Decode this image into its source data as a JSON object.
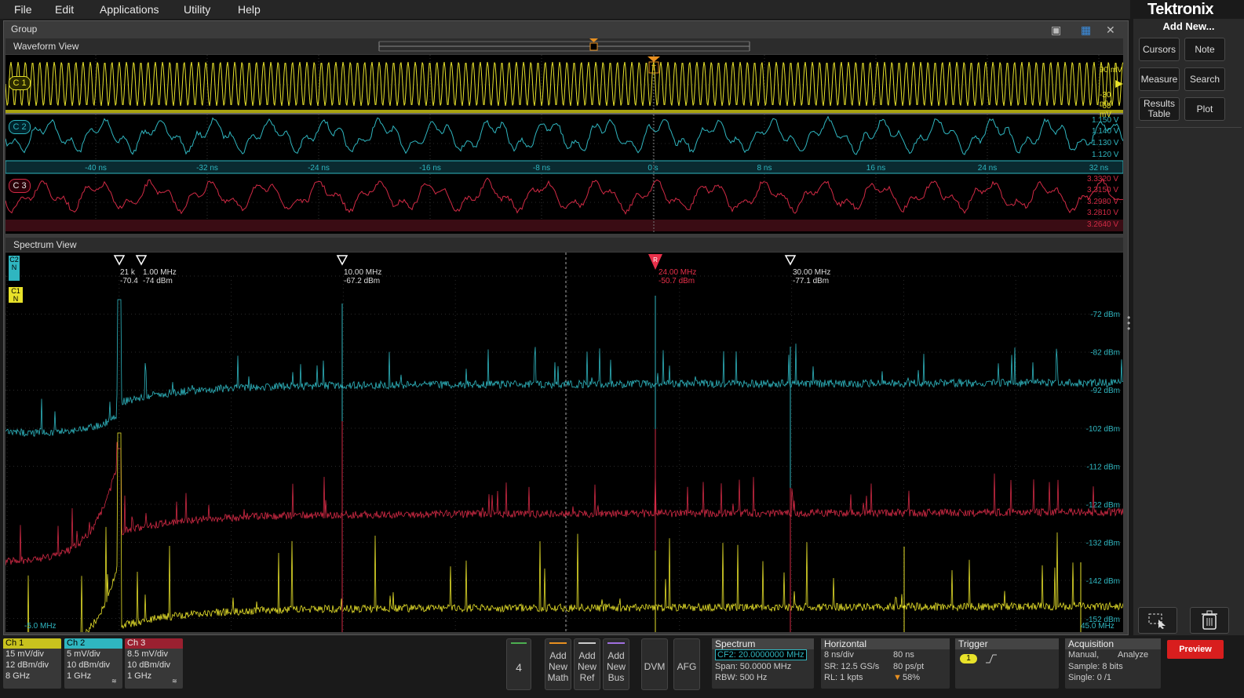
{
  "menu": [
    "File",
    "Edit",
    "Applications",
    "Utility",
    "Help"
  ],
  "brand": "Tektronix",
  "group": {
    "title": "Group"
  },
  "waveform_view": {
    "title": "Waveform View",
    "channels": [
      {
        "label": "C 1",
        "color": "#e8e22a",
        "scale_labels": [
          "90 mV",
          "-30 mV",
          "-60 mV"
        ]
      },
      {
        "label": "C 2",
        "color": "#2fb6c0",
        "scale_labels": [
          "1.150 V",
          "1.140 V",
          "1.130 V",
          "1.120 V"
        ]
      },
      {
        "label": "C 3",
        "color": "#d22a45",
        "scale_labels": [
          "3.3320 V",
          "3.3150 V",
          "3.2980 V",
          "3.2810 V",
          "3.2640 V"
        ]
      }
    ],
    "time_ticks": [
      "-40 ns",
      "-32 ns",
      "-24 ns",
      "-16 ns",
      "-8 ns",
      "0 s",
      "8 ns",
      "16 ns",
      "24 ns",
      "32 ns"
    ],
    "trigger_marker": "T"
  },
  "spectrum_view": {
    "title": "Spectrum View",
    "markers": [
      {
        "freq": "21 kHz",
        "level": "-70.4",
        "freq_short": "21 k"
      },
      {
        "freq": "1.00 MHz",
        "level": "-74 dBm"
      },
      {
        "freq": "10.00 MHz",
        "level": "-67.2 dBm"
      },
      {
        "freq": "24.00 MHz",
        "level": "-50.7 dBm",
        "ref": "R"
      },
      {
        "freq": "30.00 MHz",
        "level": "-77.1 dBm"
      }
    ],
    "db_ticks": [
      "-72 dBm",
      "-82 dBm",
      "-92 dBm",
      "-102 dBm",
      "-112 dBm",
      "-122 dBm",
      "-132 dBm",
      "-142 dBm",
      "-152 dBm"
    ],
    "start_freq": "-5.0 MHz",
    "stop_freq": "45.0 MHz",
    "chan_tags": [
      {
        "label": "C2",
        "sub": "N",
        "color": "#2fb6c0"
      },
      {
        "label": "C1",
        "sub": "N",
        "color": "#e8e22a"
      }
    ]
  },
  "right_panel": {
    "add_new": "Add New...",
    "buttons": [
      "Cursors",
      "Note",
      "Measure",
      "Search",
      "Results Table",
      "Plot"
    ]
  },
  "channels_bar": [
    {
      "name": "Ch 1",
      "lines": [
        "15 mV/div",
        "12 dBm/div",
        "8 GHz"
      ],
      "color": "#c8c21e",
      "text_color": "#000"
    },
    {
      "name": "Ch 2",
      "lines": [
        "5 mV/div",
        "10 dBm/div",
        "1 GHz"
      ],
      "color": "#2fb6c0",
      "text_color": "#000"
    },
    {
      "name": "Ch 3",
      "lines": [
        "8.5 mV/div",
        "10 dBm/div",
        "1 GHz"
      ],
      "color": "#9a2030",
      "text_color": "#eee"
    }
  ],
  "add_buttons": {
    "channel_count": "4",
    "math": [
      "Add",
      "New",
      "Math"
    ],
    "ref": [
      "Add",
      "New",
      "Ref"
    ],
    "bus": [
      "Add",
      "New",
      "Bus"
    ],
    "dvm": "DVM",
    "afg": "AFG"
  },
  "spectrum_badge": {
    "title": "Spectrum",
    "cf": "CF2: 20.0000000 MHz",
    "span": "Span: 50.0000 MHz",
    "rbw": "RBW: 500 Hz"
  },
  "horizontal_badge": {
    "title": "Horizontal",
    "l1a": "8 ns/div",
    "l1b": "80 ns",
    "l2a": "SR: 12.5 GS/s",
    "l2b": "80 ps/pt",
    "l3a": "RL: 1 kpts",
    "l3b": "58%"
  },
  "trigger_badge": {
    "title": "Trigger",
    "source": "1"
  },
  "acquisition_badge": {
    "title": "Acquisition",
    "mode": "Manual,",
    "action": "Analyze",
    "sample": "Sample: 8 bits",
    "single": "Single: 0 /1"
  },
  "preview": "Preview",
  "colors": {
    "ch1": "#e8e22a",
    "ch2": "#2fb6c0",
    "ch3": "#d22a45",
    "preview": "#d81e1e"
  }
}
